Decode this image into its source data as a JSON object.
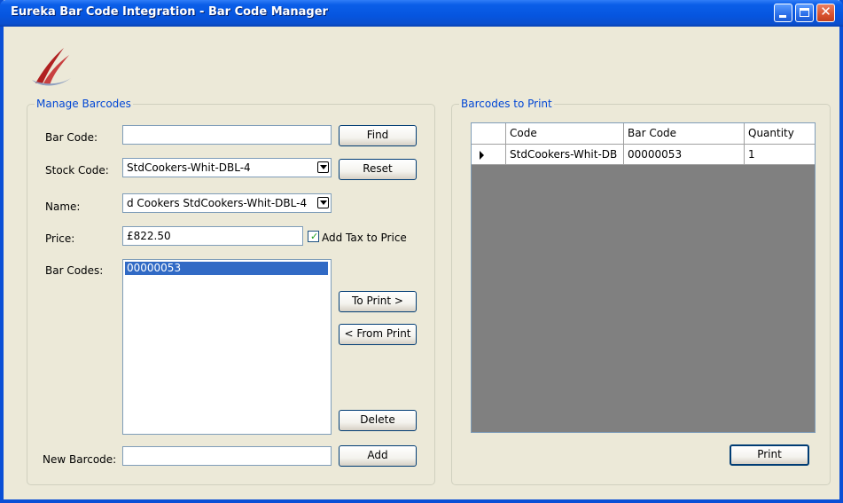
{
  "window": {
    "title": "Eureka Bar Code Integration - Bar Code Manager"
  },
  "manage": {
    "group_label": "Manage Barcodes",
    "bar_code_label": "Bar Code:",
    "bar_code_value": "",
    "find_label": "Find",
    "stock_code_label": "Stock Code:",
    "stock_code_value": "StdCookers-Whit-DBL-4",
    "reset_label": "Reset",
    "name_label": "Name:",
    "name_value": "d Cookers StdCookers-Whit-DBL-4",
    "price_label": "Price:",
    "price_value": "£822.50",
    "add_tax_label": "Add Tax to Price",
    "add_tax_checked": true,
    "bar_codes_label": "Bar Codes:",
    "bar_codes": [
      "00000053"
    ],
    "to_print_label": "To Print >",
    "from_print_label": "< From Print",
    "delete_label": "Delete",
    "new_barcode_label": "New Barcode:",
    "new_barcode_value": "",
    "add_label": "Add"
  },
  "print": {
    "group_label": "Barcodes to Print",
    "columns": [
      "Code",
      "Bar Code",
      "Quantity"
    ],
    "rows": [
      {
        "code": "StdCookers-Whit-DB",
        "bar_code": "00000053",
        "quantity": "1"
      }
    ],
    "print_label": "Print"
  },
  "icons": [
    "logo-icon",
    "minimize-icon",
    "maximize-icon",
    "close-icon",
    "chevron-down-icon",
    "row-pointer-icon",
    "checkmark-icon"
  ]
}
